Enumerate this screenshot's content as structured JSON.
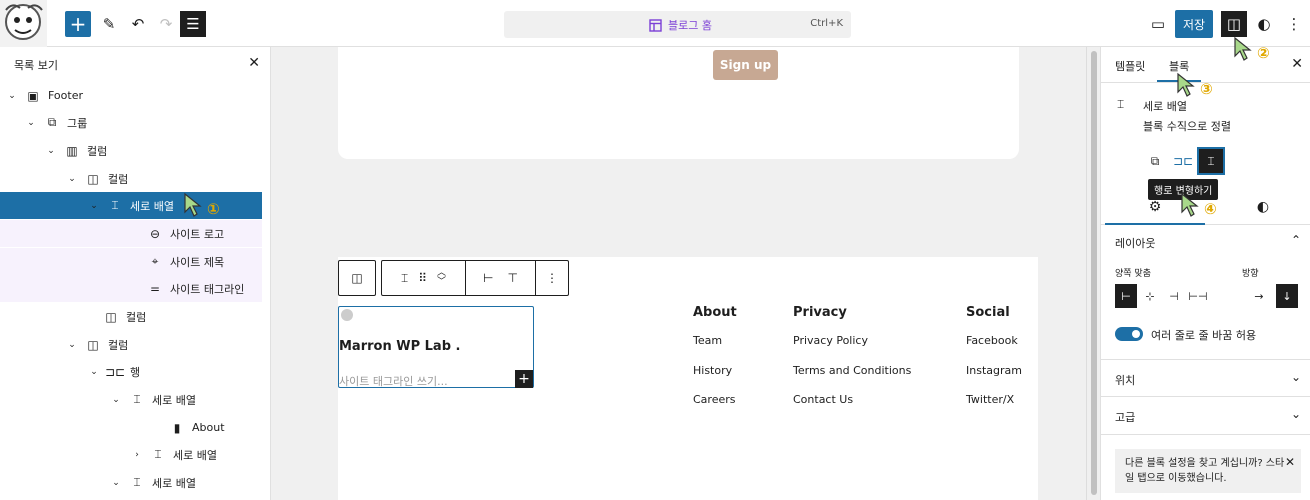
{
  "topbar": {
    "add_icon": "+",
    "pen_icon": "✎",
    "undo_icon": "↶",
    "redo_icon": "↷",
    "list_icon": "☰",
    "command": {
      "title": "블로그 홈",
      "shortcut": "Ctrl+K"
    },
    "save_label": "저장",
    "view_icon": "▭",
    "settings_icon": "◫",
    "styles_icon": "◐",
    "more_icon": "⋮"
  },
  "listview": {
    "title": "목록 보기",
    "close_icon": "✕",
    "rows": [
      {
        "chev": "⌄",
        "icon": "▣",
        "label": "Footer"
      },
      {
        "chev": "⌄",
        "icon": "⧉",
        "label": "그룹"
      },
      {
        "chev": "⌄",
        "icon": "▥",
        "label": "컬럼"
      },
      {
        "chev": "⌄",
        "icon": "◫",
        "label": "컬럼"
      },
      {
        "chev": "⌄",
        "icon": "⌶",
        "label": "세로 배열"
      },
      {
        "chev": "",
        "icon": "⊖",
        "label": "사이트 로고"
      },
      {
        "chev": "",
        "icon": "⌖",
        "label": "사이트 제목"
      },
      {
        "chev": "",
        "icon": "=",
        "label": "사이트 태그라인"
      },
      {
        "chev": "",
        "icon": "◫",
        "label": "컬럼"
      },
      {
        "chev": "⌄",
        "icon": "◫",
        "label": "컬럼"
      },
      {
        "chev": "⌄",
        "icon": "⊐⊏",
        "label": "행"
      },
      {
        "chev": "⌄",
        "icon": "⌶",
        "label": "세로 배열"
      },
      {
        "chev": "",
        "icon": "▮",
        "label": "About"
      },
      {
        "chev": "›",
        "icon": "⌶",
        "label": "세로 배열"
      },
      {
        "chev": "⌄",
        "icon": "⌶",
        "label": "세로 배열"
      }
    ]
  },
  "canvas": {
    "signup_label": "Sign up",
    "site_title": "Marron WP Lab .",
    "tagline_placeholder": "사이트 태그라인 쓰기...",
    "add_block_icon": "+",
    "columns": [
      {
        "heading": "About",
        "links": [
          "Team",
          "History",
          "Careers"
        ]
      },
      {
        "heading": "Privacy",
        "links": [
          "Privacy Policy",
          "Terms and Conditions",
          "Contact Us"
        ]
      },
      {
        "heading": "Social",
        "links": [
          "Facebook",
          "Instagram",
          "Twitter/X"
        ]
      }
    ]
  },
  "sidebar": {
    "tabs": [
      "템플릿",
      "블록"
    ],
    "close_icon": "✕",
    "block_icon": "⌶",
    "block_title": "세로 배열",
    "block_desc": "블록 수직으로 정렬",
    "variation_group_icon": "⧉",
    "variation_row_icon": "⊐⊏",
    "variation_stack_icon": "⌶",
    "tooltip": "행로 변형하기",
    "settings_tab_icon": "⚙",
    "styles_tab_icon": "◐",
    "layout_title": "레이아웃",
    "justify_label": "양쪽 맞춤",
    "direction_label": "방향",
    "justify_icons": [
      "⊢",
      "⊹",
      "⊣",
      "⊢⊣"
    ],
    "direction_icons": [
      "→",
      "↓"
    ],
    "wrap_label": "여러 줄로 줄 바꿈 허용",
    "position_title": "위치",
    "advanced_title": "고급",
    "notice": "다른 블록 설정을 찾고 계십니까? 스타일 탭으로 이동했습니다.",
    "notice_close_icon": "✕",
    "chev_up": "⌃",
    "chev_down": "⌄"
  },
  "annotations": [
    "①",
    "②",
    "③",
    "④"
  ]
}
